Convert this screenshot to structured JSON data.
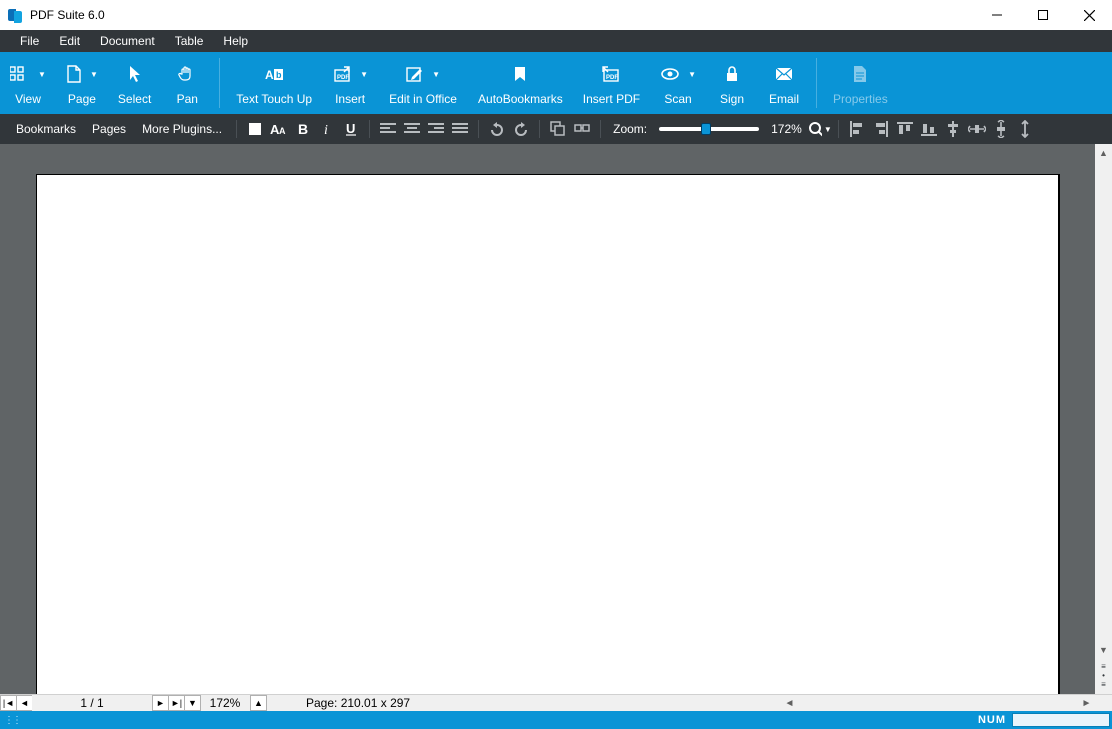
{
  "app": {
    "title": "PDF Suite 6.0"
  },
  "menu": {
    "file": "File",
    "edit": "Edit",
    "document": "Document",
    "table": "Table",
    "help": "Help"
  },
  "ribbon": {
    "view": "View",
    "page": "Page",
    "select": "Select",
    "pan": "Pan",
    "texttouchup": "Text Touch Up",
    "insert": "Insert",
    "editinoffice": "Edit in Office",
    "autobookmarks": "AutoBookmarks",
    "insertpdf": "Insert PDF",
    "scan": "Scan",
    "sign": "Sign",
    "email": "Email",
    "properties": "Properties"
  },
  "toolbar": {
    "bookmarks": "Bookmarks",
    "pages": "Pages",
    "moreplugins": "More Plugins...",
    "zoom_label": "Zoom:",
    "zoom_value": "172%"
  },
  "nav": {
    "page_of": "1 / 1",
    "zoom": "172%",
    "pagesize": "Page: 210.01 x 297"
  },
  "status": {
    "num": "NUM"
  }
}
